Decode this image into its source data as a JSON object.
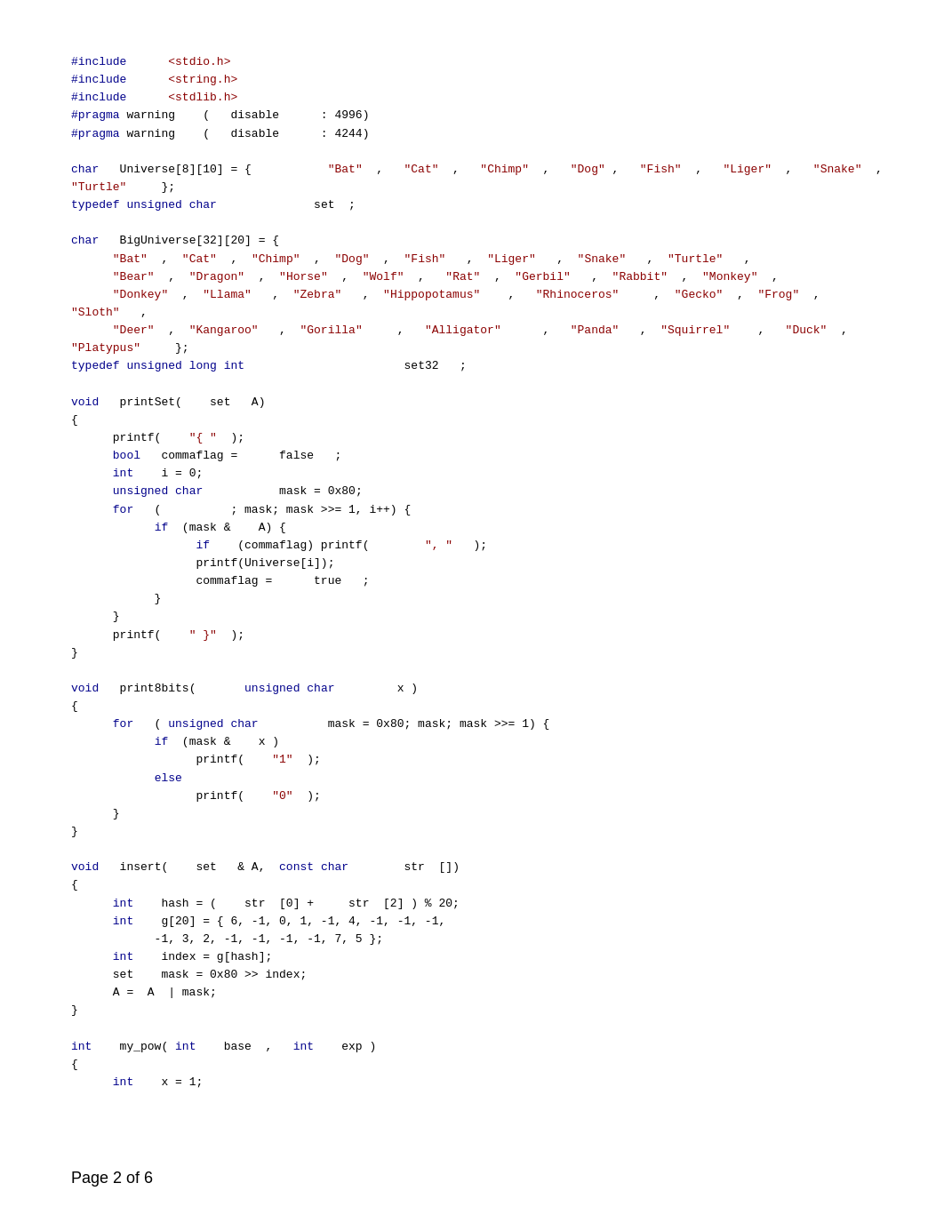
{
  "page": {
    "current": 2,
    "total": 6,
    "footer_label": "Page 2 of 6"
  },
  "code": {
    "lines": "code content"
  }
}
